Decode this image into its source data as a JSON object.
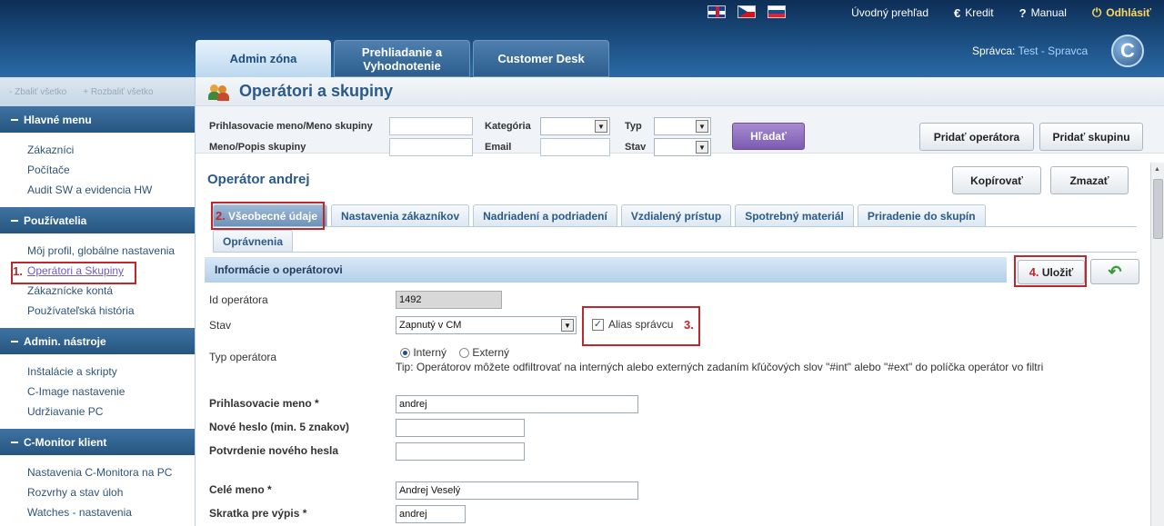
{
  "top_nav": {
    "flags": [
      "flag-uk",
      "flag-cz",
      "flag-sk"
    ],
    "overview": "Úvodný prehľad",
    "credit": "Kredit",
    "manual": "Manual",
    "logout": "Odhlásiť"
  },
  "main_tabs": [
    "Admin zóna",
    "Prehliadanie a Vyhodnotenie",
    "Customer Desk"
  ],
  "admin": {
    "label": "Správca:",
    "name": "Test - Spravca"
  },
  "sidebar": {
    "collapse_all": "- Zbaliť všetko",
    "expand_all": "+ Rozbaliť všetko",
    "sections": [
      {
        "title": "Hlavné menu",
        "items": [
          "Zákazníci",
          "Počítače",
          "Audit SW a evidencia HW"
        ]
      },
      {
        "title": "Používatelia",
        "items": [
          "Môj profil, globálne nastavenia",
          "Operátori a Skupiny",
          "Zákaznícke kontá",
          "Používateľská história"
        ]
      },
      {
        "title": "Admin. nástroje",
        "items": [
          "Inštalácie a skripty",
          "C-Image nastavenie",
          "Udržiavanie PC"
        ]
      },
      {
        "title": "C-Monitor klient",
        "items": [
          "Nastavenia C-Monitora na PC",
          "Rozvrhy a stav úloh",
          "Watches - nastavenia"
        ]
      }
    ],
    "active_item_marker": "1."
  },
  "page": {
    "title": "Operátori a skupiny"
  },
  "filter": {
    "login_label": "Prihlasovacie meno/Meno skupiny",
    "desc_label": "Meno/Popis skupiny",
    "category_label": "Kategória",
    "email_label": "Email",
    "type_label": "Typ",
    "state_label": "Stav",
    "search_button": "Hľadať",
    "add_operator": "Pridať operátora",
    "add_group": "Pridať skupinu"
  },
  "operator": {
    "title": "Operátor andrej",
    "copy_button": "Kopírovať",
    "delete_button": "Zmazať"
  },
  "subtabs": [
    "Všeobecné údaje",
    "Nastavenia zákazníkov",
    "Nadriadení a podriadení",
    "Vzdialený prístup",
    "Spotrebný materiál",
    "Priradenie do skupín",
    "Oprávnenia"
  ],
  "markers": {
    "tab": "2.",
    "alias": "3.",
    "save": "4."
  },
  "form": {
    "section_title": "Informácie o operátorovi",
    "save_button": "Uložiť",
    "id_label": "Id operátora",
    "id_value": "1492",
    "state_label": "Stav",
    "state_value": "Zapnutý v CM",
    "alias_label": "Alias správcu",
    "type_label": "Typ operátora",
    "type_internal": "Interný",
    "type_external": "Externý",
    "tip": "Tip: Operátorov môžete odfiltrovať na interných alebo externých zadaním kľúčových slov \"#int\" alebo \"#ext\" do políčka operátor vo filtri",
    "login_label": "Prihlasovacie meno *",
    "login_value": "andrej",
    "new_pw_label": "Nové heslo (min. 5 znakov)",
    "confirm_pw_label": "Potvrdenie nového hesla",
    "fullname_label": "Celé meno *",
    "fullname_value": "Andrej Veselý",
    "short_label": "Skratka pre výpis *",
    "short_value": "andrej"
  }
}
